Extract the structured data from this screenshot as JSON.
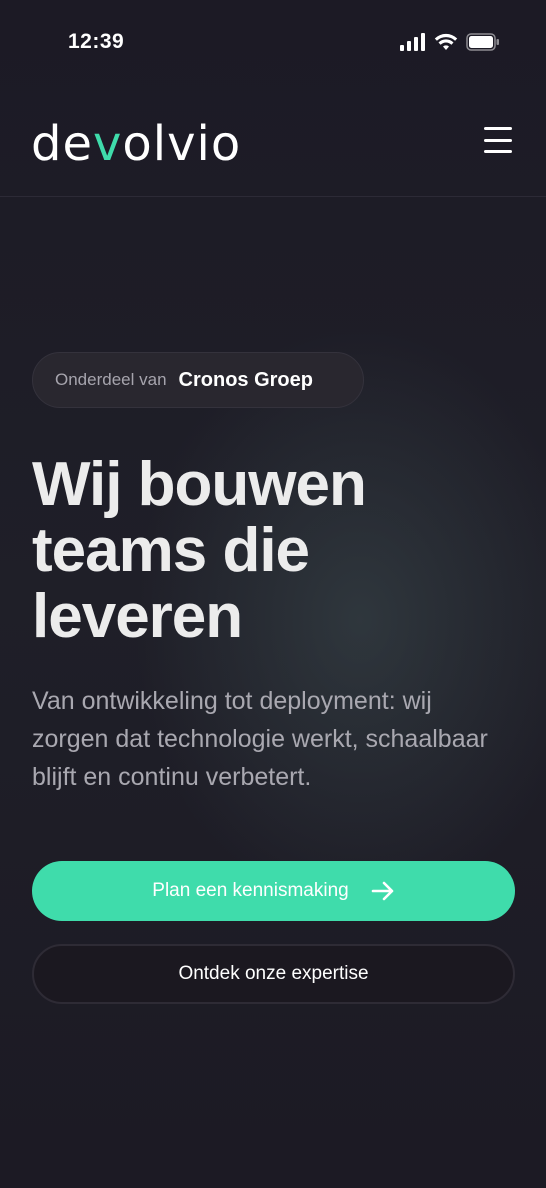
{
  "status_bar": {
    "time": "12:39"
  },
  "header": {
    "logo_pre": "de",
    "logo_accent": "v",
    "logo_post": "olvio",
    "accent_color": "#3fdcab"
  },
  "badge": {
    "prefix": "Onderdeel van",
    "name": "Cronos Groep"
  },
  "hero": {
    "title": "Wij bouwen\nteams die\nleveren",
    "subtitle": "Van ontwikkeling tot deployment: wij zorgen dat technologie werkt, schaalbaar blijft en continu verbetert."
  },
  "buttons": {
    "primary_label": "Plan een kennismaking",
    "primary_icon": "arrow-right-icon",
    "secondary_label": "Ontdek onze expertise"
  },
  "colors": {
    "background": "#1d1b26",
    "accent": "#3fdcab"
  }
}
